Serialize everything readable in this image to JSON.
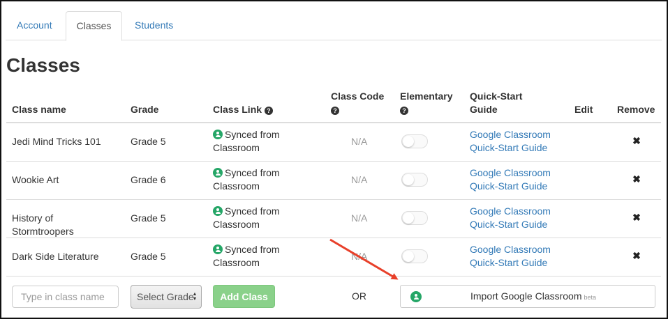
{
  "tabs": [
    {
      "label": "Account",
      "active": false
    },
    {
      "label": "Classes",
      "active": true
    },
    {
      "label": "Students",
      "active": false
    }
  ],
  "page": {
    "title": "Classes"
  },
  "table": {
    "headers": {
      "class_name": "Class name",
      "grade": "Grade",
      "class_link": "Class Link",
      "class_code": "Class Code",
      "elementary": "Elementary",
      "quick_start_line1": "Quick-Start",
      "quick_start_line2": "Guide",
      "edit": "Edit",
      "remove": "Remove"
    },
    "rows": [
      {
        "name_line1": "Jedi Mind Tricks 101",
        "name_line2": "",
        "grade": "Grade 5",
        "link_line1": "Synced from",
        "link_line2": "Classroom",
        "code": "N/A",
        "elementary": false,
        "guide_line1": "Google Classroom",
        "guide_line2": "Quick-Start Guide",
        "remove": "✖"
      },
      {
        "name_line1": "Wookie Art",
        "name_line2": "",
        "grade": "Grade 6",
        "link_line1": "Synced from",
        "link_line2": "Classroom",
        "code": "N/A",
        "elementary": false,
        "guide_line1": "Google Classroom",
        "guide_line2": "Quick-Start Guide",
        "remove": "✖"
      },
      {
        "name_line1": "History of",
        "name_line2": "Stormtroopers",
        "grade": "Grade 5",
        "link_line1": "Synced from",
        "link_line2": "Classroom",
        "code": "N/A",
        "elementary": false,
        "guide_line1": "Google Classroom",
        "guide_line2": "Quick-Start Guide",
        "remove": "✖"
      },
      {
        "name_line1": "Dark Side Literature",
        "name_line2": "",
        "grade": "Grade 5",
        "link_line1": "Synced from",
        "link_line2": "Classroom",
        "code": "N/A",
        "elementary": false,
        "guide_line1": "Google Classroom",
        "guide_line2": "Quick-Start Guide",
        "remove": "✖"
      }
    ]
  },
  "form": {
    "class_name_placeholder": "Type in class name",
    "grade_select_value": "Select Grade",
    "add_button": "Add Class",
    "or_label": "OR",
    "import_button": "Import Google Classroom",
    "beta_label": "beta"
  },
  "icons": {
    "help": "question-circle-icon",
    "classroom": "google-classroom-icon",
    "remove": "close-x-icon"
  },
  "colors": {
    "link": "#337ab7",
    "add_button": "#8ad18a",
    "classroom_green": "#25a667",
    "arrow": "#e8402a"
  }
}
